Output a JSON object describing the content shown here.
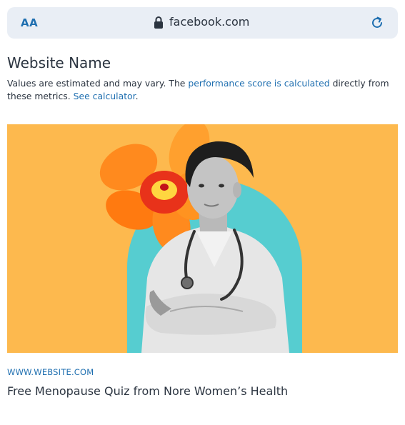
{
  "browser": {
    "text_size_label": "AA",
    "url": "facebook.com",
    "icons": [
      "lock-icon",
      "reload-icon"
    ]
  },
  "site": {
    "name": "Website Name",
    "description_prefix": "Values are estimated and may vary. The ",
    "performance_link": "performance score is calculated",
    "description_middle": " directly from these metrics. ",
    "calculator_link": "See calculator",
    "description_suffix": "."
  },
  "card": {
    "source": "WWW.WEBSITE.COM",
    "headline": "Free Menopause Quiz from Nore Women’s Health"
  },
  "colors": {
    "accent": "#1f6fb0",
    "urlbar_bg": "#e9eef5",
    "hero_bg": "#fdb94e",
    "arch": "#56cdd0",
    "flower": "#ff7a10"
  }
}
